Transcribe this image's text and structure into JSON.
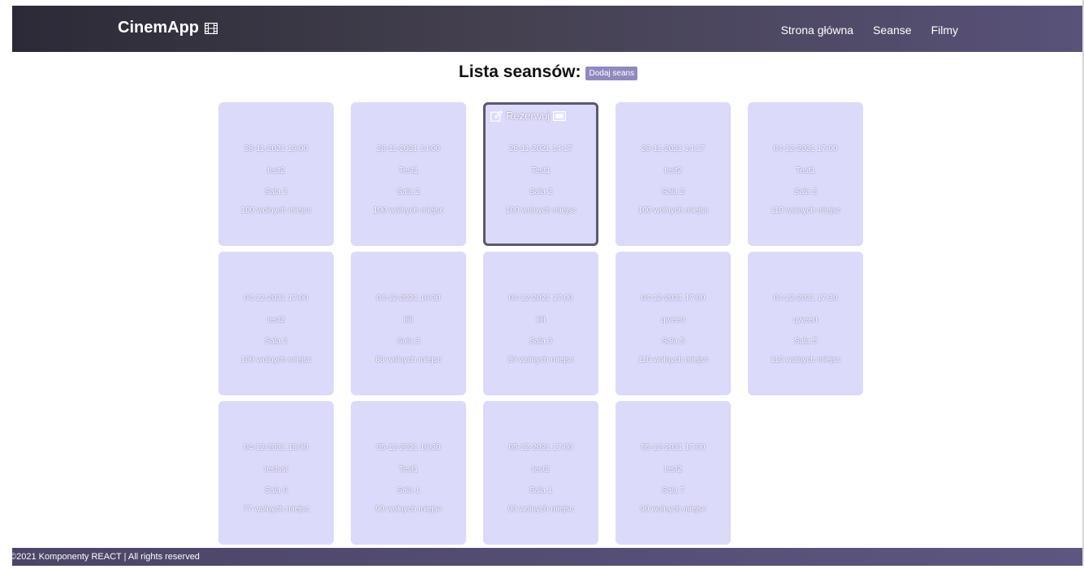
{
  "navbar": {
    "brand": "CinemApp",
    "links": [
      "Strona główna",
      "Seanse",
      "Filmy"
    ]
  },
  "heading": {
    "title": "Lista seansów:",
    "add_button": "Dodaj seans"
  },
  "card_actions": {
    "reserve_label": "Rezerwuj"
  },
  "screenings": [
    {
      "datetime": "28-11-2021 19:00",
      "title": "test2",
      "room": "Sala 2",
      "seats": "100 wolnych miejsc"
    },
    {
      "datetime": "28-11-2021 14:00",
      "title": "Test1",
      "room": "Sala 2",
      "seats": "100 wolnych miejsc"
    },
    {
      "datetime": "28-11-2021 14:17",
      "title": "Test1",
      "room": "Sala 2",
      "seats": "100 wolnych miejsc"
    },
    {
      "datetime": "28-11-2021 14:17",
      "title": "test2",
      "room": "Sala 2",
      "seats": "100 wolnych miejsc"
    },
    {
      "datetime": "04-12-2021 17:00",
      "title": "Test1",
      "room": "Sala 5",
      "seats": "110 wolnych miejsc"
    },
    {
      "datetime": "04-12-2021 17:00",
      "title": "test2",
      "room": "Sala 2",
      "seats": "100 wolnych miejsc"
    },
    {
      "datetime": "04-12-2021 16:30",
      "title": "iiiii",
      "room": "Sala 3",
      "seats": "80 wolnych miejsc"
    },
    {
      "datetime": "04-12-2021 17:00",
      "title": "iiiii",
      "room": "Sala 3",
      "seats": "80 wolnych miejsc"
    },
    {
      "datetime": "04-12-2021 17:00",
      "title": "qweert",
      "room": "Sala 5",
      "seats": "110 wolnych miejsc"
    },
    {
      "datetime": "04-12-2021 17:30",
      "title": "qweert",
      "room": "Sala 5",
      "seats": "110 wolnych miejsc"
    },
    {
      "datetime": "04-12-2021 18:30",
      "title": "testsst",
      "room": "Sala 6",
      "seats": "77 wolnych miejsc"
    },
    {
      "datetime": "05-12-2021 16:30",
      "title": "Test1",
      "room": "Sala 1",
      "seats": "90 wolnych miejsc"
    },
    {
      "datetime": "05-12-2021 17:00",
      "title": "test2",
      "room": "Sala 1",
      "seats": "90 wolnych miejsc"
    },
    {
      "datetime": "05-12-2021 17:00",
      "title": "test2",
      "room": "Sala 7",
      "seats": "90 wolnych miejsc"
    }
  ],
  "footer": {
    "text": "©2021 Komponenty REACT | All rights reserved"
  },
  "colors": {
    "card_bg": "#dcdafb",
    "card_active_border": "#5b5773",
    "navbar_dark": "#2c2a37",
    "navbar_light": "#59527a",
    "accent_button": "#8f89c0"
  }
}
